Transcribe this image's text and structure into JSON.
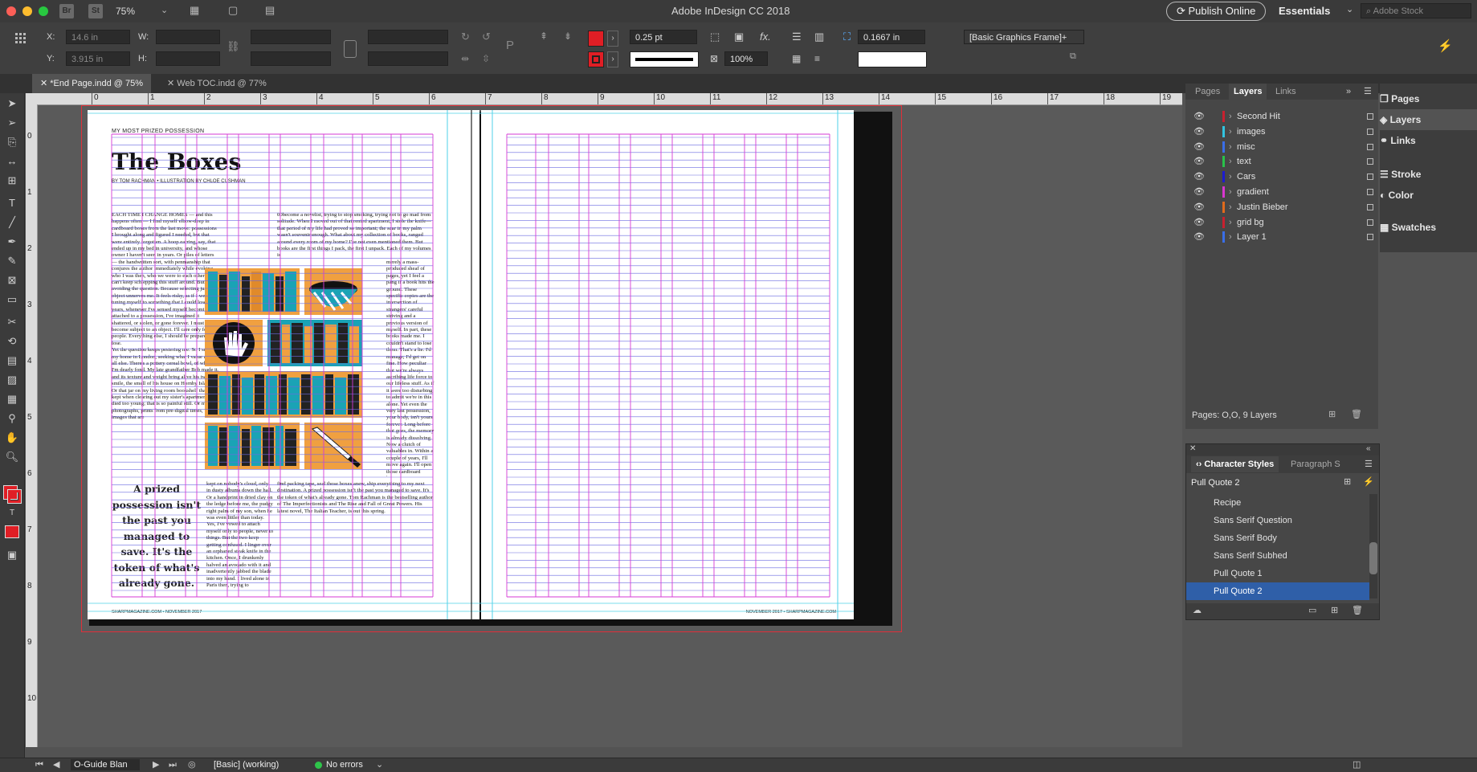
{
  "app": {
    "title": "Adobe InDesign CC 2018",
    "zoom": "75%",
    "publish_label": "Publish Online",
    "workspace": "Essentials",
    "search_placeholder": "Adobe Stock",
    "bridge_label": "Br",
    "stock_label": "St"
  },
  "control": {
    "x_label": "X:",
    "x_value": "14.6 in",
    "y_label": "Y:",
    "y_value": "3.915 in",
    "w_label": "W:",
    "h_label": "H:",
    "stroke_weight": "0.25 pt",
    "opacity": "100%",
    "offset": "0.1667 in",
    "object_style": "[Basic Graphics Frame]+"
  },
  "doc_tabs": [
    {
      "label": "*End Page.indd @ 75%",
      "active": true
    },
    {
      "label": "Web TOC.indd @ 77%",
      "active": false
    }
  ],
  "ruler": {
    "h_ticks": [
      "0",
      "1",
      "2",
      "3",
      "4",
      "5",
      "6",
      "7",
      "8",
      "9",
      "10",
      "11",
      "12",
      "13",
      "14",
      "15",
      "16",
      "17",
      "18",
      "19"
    ],
    "v_ticks": [
      "0",
      "1",
      "2",
      "3",
      "4",
      "5",
      "6",
      "7",
      "8",
      "9",
      "10"
    ]
  },
  "spread": {
    "kicker": "MY MOST PRIZED POSSESSION",
    "headline": "The Boxes",
    "byline": "BY TOM RACHMAN • ILLUSTRATION BY CHLOE CUSHMAN",
    "col1_top": "EACH TIME I CHANGE HOMES — and this happens often — I find myself elbow-deep in cardboard boxes from the last move: possessions I brought along and figured I needed, but that were entirely forgotten. A hoop earring, say, that ended up in my bed in university, and whose owner I haven't seen in years. Or piles of letters — the handwritten sort, with penmanship that conjures the author immediately while evoking who I was then, who we were to each other. I can't keep schlepping this stuff around. But I'm avoiding the question. Because selecting just one object unnerves me. It feels risky, as if I were tuning myself to something that I could lose. For years, whenever I've sensed myself becoming attached to a possession, I've imagined it shattered, or stolen, or gone forever. I must never become subject to an object. I'll care only for people. Everything else, I should be prepared to lose.",
    "col1_mid": "Yet the question keeps pestering me. So I scour my home in London, seeking what I value above all else. There's a pottery cereal bowl, of which I'm dearly fond. My late grandfather Bob made it, and its texture and weight bring alive his twitchy smile, the smell of his house on Hornby Island. Or that jar on my living room bookshelf that I kept when clearing out my sister's apartment. She died too young; that is so painful still. Or my photographs, prints from pre-digital times, images that are",
    "col2_top": "00become a novelist, trying to stop smoking, trying not to go mad from solitude. When I moved out of that rented apartment, I stole the knife— that period of my life had proved so important; the scar in my palm wasn't souvenir enough. What about my collection of books, ranged around every room of my home? I've not even mentioned them. But books are the first things I pack, the first I unpack. Each of my volumes is",
    "col3_side": "merely a mass-produced sheaf of pages, yet I feel a pang if a book hits the ground. These specific copies are the intersection of strangers' careful striving and a previous version of myself. In part, these books made me. I couldn't stand to lose them. That's a lie. I'd manage; I'd get on fine. How peculiar that we're always ascribing life force to our lifeless stuff. As if it were too disturbing to admit we're in this alone. Yet even the very last possession, your body, isn't yours forever. Long before that goes, the memory is already dissolving. Now a clutch of valuables in. Within a couple of years, I'll move again. I'll open those cardboard boxes, resuscitate my castaway possessions, which I never need but dread to lose. I'll",
    "pull_quote": "A prized possession isn't the past you managed to save. It's the token of what's already gone.",
    "col2_bottom": "kept on nobody's cloud, only in dusty albums down the hall. Or a handprint in dried clay on the ledge before me, the pudgy right palm of my son, when he was even littler than today. Yes, I've vowed to attach myself only to people, never to things. But the two keep getting confused. I linger over an orphaned steak knife in the kitchen. Once, I drunkenly halved an avocado with it and inadvertently jabbed the blade into my hand. I lived alone in Paris then, trying to",
    "col3_bottom": "find packing tape, seal those boxes anew, ship everything to my next destination. A prized possession isn't the past you managed to save. It's the token of what's already gone. Tom Rachman is the bestselling author of The Imperfectionists and The Rise and Fall of Great Powers. His latest novel, The Italian Teacher, is out this spring.",
    "folio_left": "SHARPMAGAZINE.COM • NOVEMBER 2017",
    "folio_right": "NOVEMBER 2017 • SHARPMAGAZINE.COM"
  },
  "layers_panel": {
    "tabs": [
      "Pages",
      "Layers",
      "Links"
    ],
    "active_tab": "Layers",
    "layers": [
      {
        "name": "Second Hit",
        "color": "#c8202f"
      },
      {
        "name": "images",
        "color": "#32c4e0"
      },
      {
        "name": "misc",
        "color": "#3a6ee8"
      },
      {
        "name": "text",
        "color": "#29c24a"
      },
      {
        "name": "Cars",
        "color": "#1c1cd0"
      },
      {
        "name": "gradient",
        "color": "#d936d0"
      },
      {
        "name": "Justin Bieber",
        "color": "#e06a1c"
      },
      {
        "name": "grid bg",
        "color": "#c8202f"
      },
      {
        "name": "Layer 1",
        "color": "#3a6ee8"
      }
    ],
    "footer": "Pages: O,O, 9 Layers"
  },
  "side_panels": [
    "Pages",
    "Layers",
    "Links",
    "Stroke",
    "Color",
    "Swatches"
  ],
  "char_styles_panel": {
    "tabs": [
      "Character Styles",
      "Paragraph S"
    ],
    "current": "Pull Quote 2",
    "styles": [
      "Recipe",
      "Sans Serif Question",
      "Sans Serif Body",
      "Sans Serif Subhed",
      "Pull Quote 1",
      "Pull Quote 2"
    ],
    "selected": "Pull Quote 2"
  },
  "status_bar": {
    "page": "O-Guide Blan",
    "mode": "[Basic] (working)",
    "errors": "No errors"
  },
  "colors": {
    "accent": "#2f5fa8",
    "margin_guide": "#d63ad6",
    "grid_guide": "#6a6ae0",
    "bleed": "#e0303a",
    "column_guide": "#4fd2e8",
    "teal": "#1aa3b5",
    "orange": "#f0a040"
  }
}
